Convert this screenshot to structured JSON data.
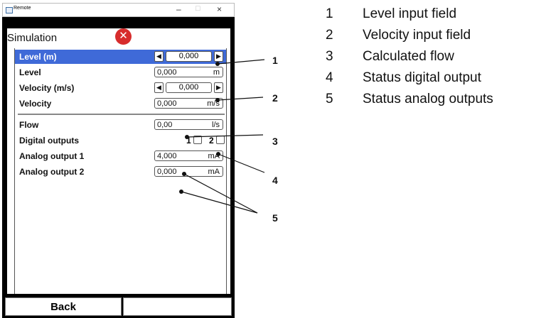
{
  "window": {
    "title": "Remote",
    "minimize": "–",
    "maximize": "□",
    "close": "×"
  },
  "screen": {
    "title": "Simulation"
  },
  "rows": {
    "level_m": {
      "label": "Level (m)",
      "value": "0,000"
    },
    "level": {
      "label": "Level",
      "value": "0,000",
      "unit": "m"
    },
    "velocity_ms": {
      "label": "Velocity (m/s)",
      "value": "0,000"
    },
    "velocity": {
      "label": "Velocity",
      "value": "0,000",
      "unit": "m/s"
    },
    "flow": {
      "label": "Flow",
      "value": "0,00",
      "unit": "l/s"
    },
    "digital_outputs": {
      "label": "Digital outputs",
      "output1": "1",
      "output2": "2"
    },
    "analog1": {
      "label": "Analog output 1",
      "value": "4,000",
      "unit": "mA"
    },
    "analog2": {
      "label": "Analog output 2",
      "value": "0,000",
      "unit": "mA"
    }
  },
  "buttons": {
    "back": "Back",
    "right": ""
  },
  "callouts": [
    "1",
    "2",
    "3",
    "4",
    "5"
  ],
  "legend": [
    {
      "num": "1",
      "text": "Level input field"
    },
    {
      "num": "2",
      "text": "Velocity input field"
    },
    {
      "num": "3",
      "text": "Calculated flow"
    },
    {
      "num": "4",
      "text": "Status digital output"
    },
    {
      "num": "5",
      "text": "Status analog outputs"
    }
  ],
  "colors": {
    "selection": "#3f6ad8",
    "error_icon": "#d72d2d"
  }
}
